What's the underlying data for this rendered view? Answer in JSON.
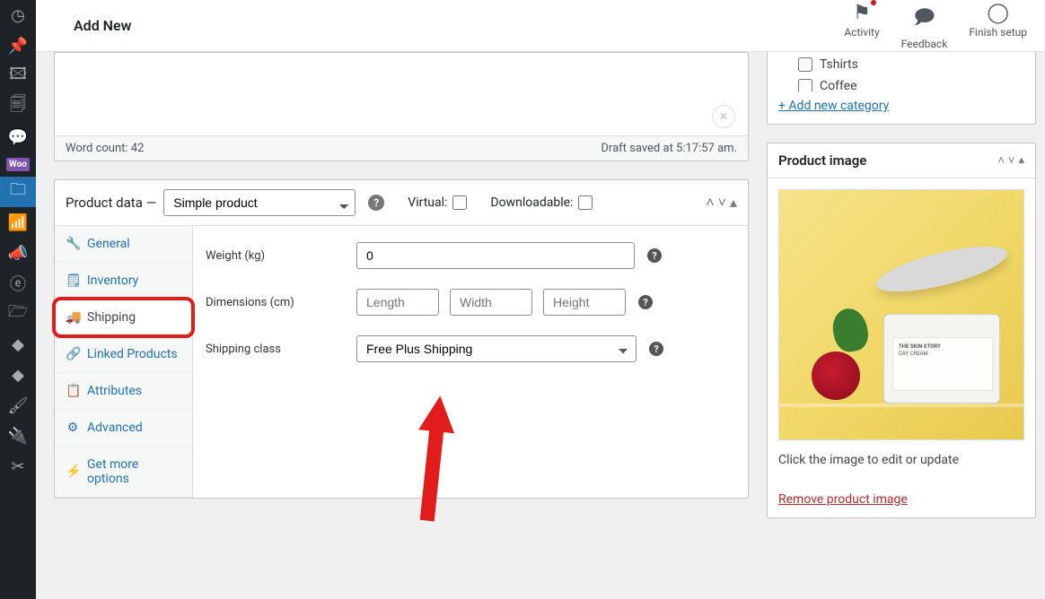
{
  "header": {
    "title": "Add New"
  },
  "top_actions": {
    "activity": "Activity",
    "feedback": "Feedback",
    "finish": "Finish setup"
  },
  "editor": {
    "word_count": "Word count: 42",
    "draft_saved": "Draft saved at 5:17:57 am."
  },
  "product_data": {
    "title": "Product data",
    "dash": " —",
    "type_selected": "Simple product",
    "virtual_label": "Virtual:",
    "download_label": "Downloadable:",
    "tabs": {
      "general": "General",
      "inventory": "Inventory",
      "shipping": "Shipping",
      "linked": "Linked Products",
      "attributes": "Attributes",
      "advanced": "Advanced",
      "getmore": "Get more options"
    },
    "fields": {
      "weight_label": "Weight (kg)",
      "weight_value": "0",
      "dims_label": "Dimensions (cm)",
      "length_ph": "Length",
      "width_ph": "Width",
      "height_ph": "Height",
      "class_label": "Shipping class",
      "class_value": "Free Plus Shipping"
    }
  },
  "categories": {
    "items": [
      "Tshirts",
      "Coffee"
    ],
    "add_new": "+ Add new category"
  },
  "product_image": {
    "title": "Product image",
    "note": "Click the image to edit or update",
    "remove": "Remove product image",
    "jar_brand": "THE SKIN STORY",
    "jar_name": "DAY CREAM"
  }
}
